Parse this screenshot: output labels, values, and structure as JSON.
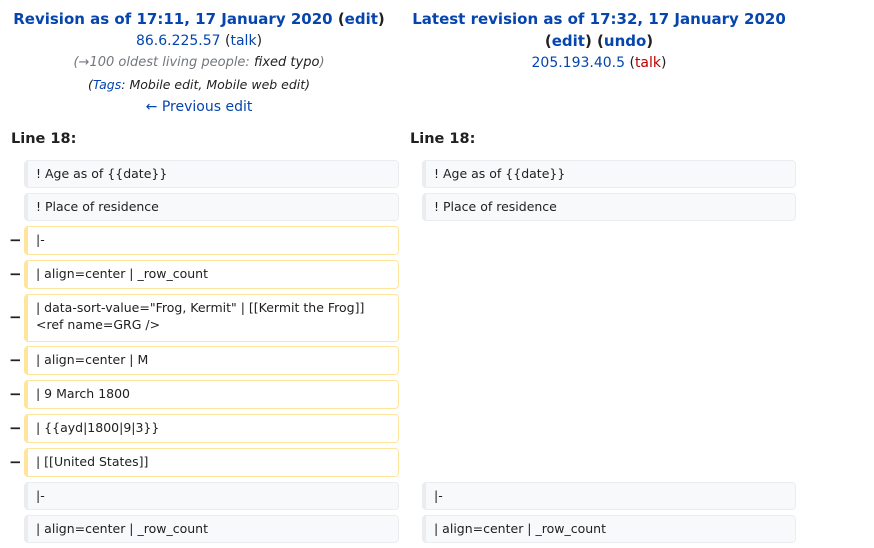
{
  "left_header": {
    "title_prefix": "Revision as of 17:11, 17 January 2020",
    "edit_label": "edit",
    "user": "86.6.225.57",
    "talk_label": "talk",
    "summary_arrow": "(→",
    "summary_section": "100 oldest living people:",
    "summary_text": " fixed typo",
    "summary_close": ")",
    "tags_open": "(",
    "tags_label": "Tags",
    "tags_list": ": Mobile edit, Mobile web edit)",
    "prev_edit": "← Previous edit"
  },
  "right_header": {
    "title_prefix": "Latest revision as of 17:32, 17 January 2020",
    "edit_label": "edit",
    "undo_label": "undo",
    "user": "205.193.40.5",
    "talk_label": "talk"
  },
  "line_numbers": {
    "left": "Line 18:",
    "right": "Line 18:"
  },
  "diff_rows": [
    {
      "type": "context",
      "left": "! Age as of {{date}}",
      "right": "! Age as of {{date}}"
    },
    {
      "type": "context",
      "left": "! Place of residence",
      "right": "! Place of residence"
    },
    {
      "type": "deleted",
      "marker": "−",
      "left": "|-"
    },
    {
      "type": "deleted",
      "marker": "−",
      "left": "| align=center | _row_count"
    },
    {
      "type": "deleted",
      "marker": "−",
      "left": "| data-sort-value=\"Frog, Kermit\" | [[Kermit the Frog]]<ref name=GRG />"
    },
    {
      "type": "deleted",
      "marker": "−",
      "left": "| align=center | M"
    },
    {
      "type": "deleted",
      "marker": "−",
      "left": "| 9 March 1800"
    },
    {
      "type": "deleted",
      "marker": "−",
      "left": "| {{ayd|1800|9|3}}"
    },
    {
      "type": "deleted",
      "marker": "−",
      "left": "| [[United States]]"
    },
    {
      "type": "context",
      "left": "|-",
      "right": "|-"
    },
    {
      "type": "context",
      "left": "| align=center | _row_count",
      "right": "| align=center | _row_count"
    }
  ]
}
